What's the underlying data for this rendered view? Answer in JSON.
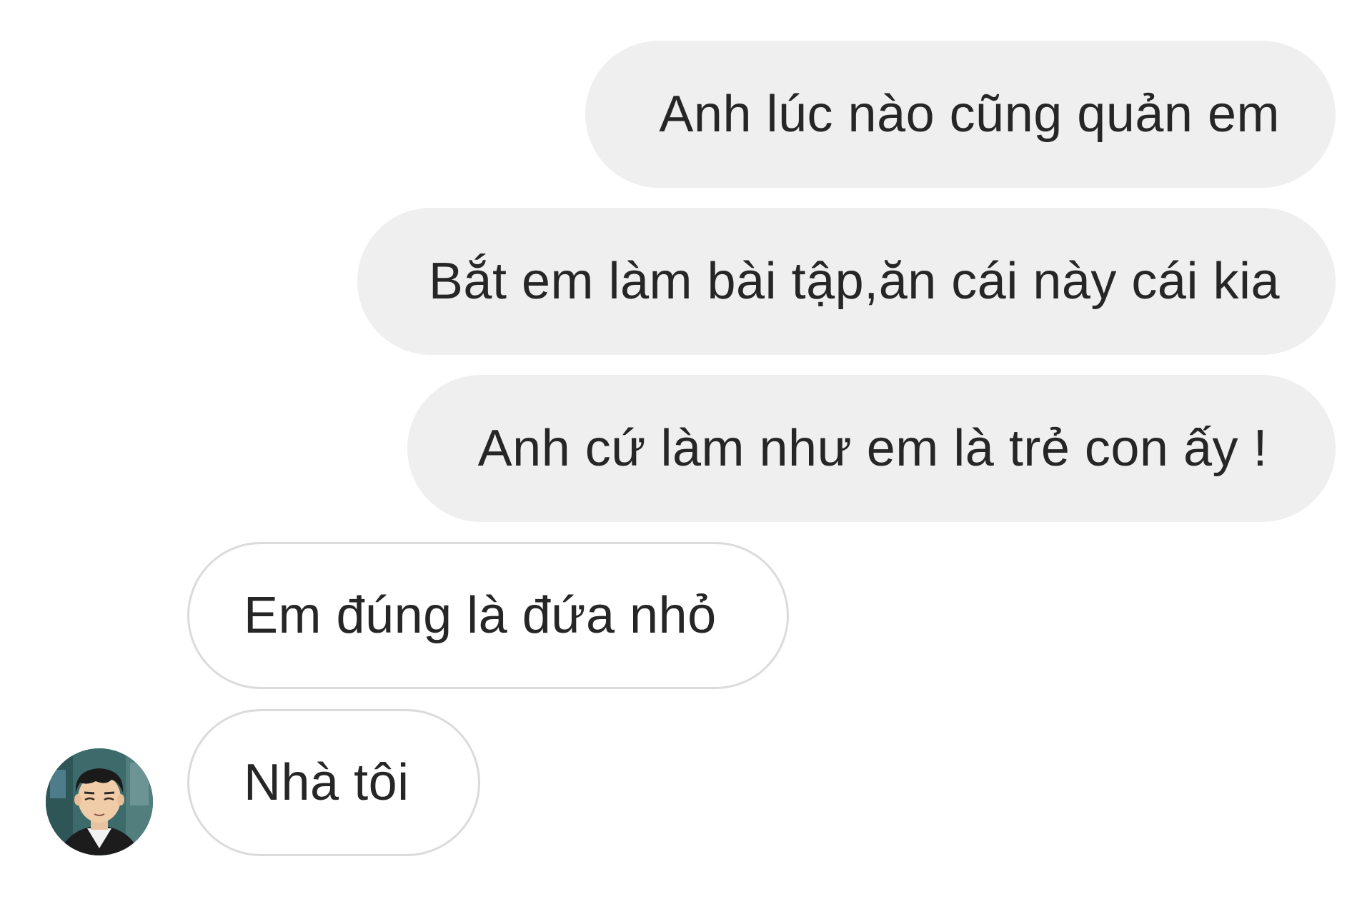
{
  "conversation": {
    "messages": [
      {
        "direction": "outgoing",
        "text": "Anh lúc nào cũng quản em"
      },
      {
        "direction": "outgoing",
        "text": "Bắt em làm bài tập,ăn cái này cái kia"
      },
      {
        "direction": "outgoing",
        "text": "Anh cứ làm như em là trẻ con ấy !"
      },
      {
        "direction": "incoming",
        "text": "Em đúng là đứa nhỏ"
      },
      {
        "direction": "incoming",
        "text": "Nhà tôi"
      }
    ]
  },
  "contact": {
    "avatar_icon": "anime-character-avatar"
  },
  "colors": {
    "outgoing_bubble": "#efefef",
    "incoming_bubble_border": "#dbdbdb",
    "text": "#262626",
    "background": "#ffffff"
  }
}
